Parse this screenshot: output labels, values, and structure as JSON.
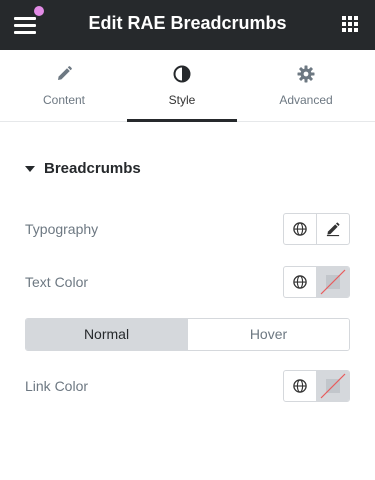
{
  "header": {
    "title": "Edit RAE Breadcrumbs"
  },
  "tabs": [
    {
      "label": "Content",
      "icon": "pencil-icon",
      "active": false
    },
    {
      "label": "Style",
      "icon": "half-circle-icon",
      "active": true
    },
    {
      "label": "Advanced",
      "icon": "gear-icon",
      "active": false
    }
  ],
  "section": {
    "title": "Breadcrumbs"
  },
  "controls": {
    "typography_label": "Typography",
    "text_color_label": "Text Color",
    "link_color_label": "Link Color"
  },
  "state_switch": {
    "normal": "Normal",
    "hover": "Hover"
  },
  "colors": {
    "header_bg": "#26292c",
    "notification_dot": "#e28be6",
    "swatch_bg": "#d5d8dc",
    "unset_slash": "#e85b5b"
  }
}
